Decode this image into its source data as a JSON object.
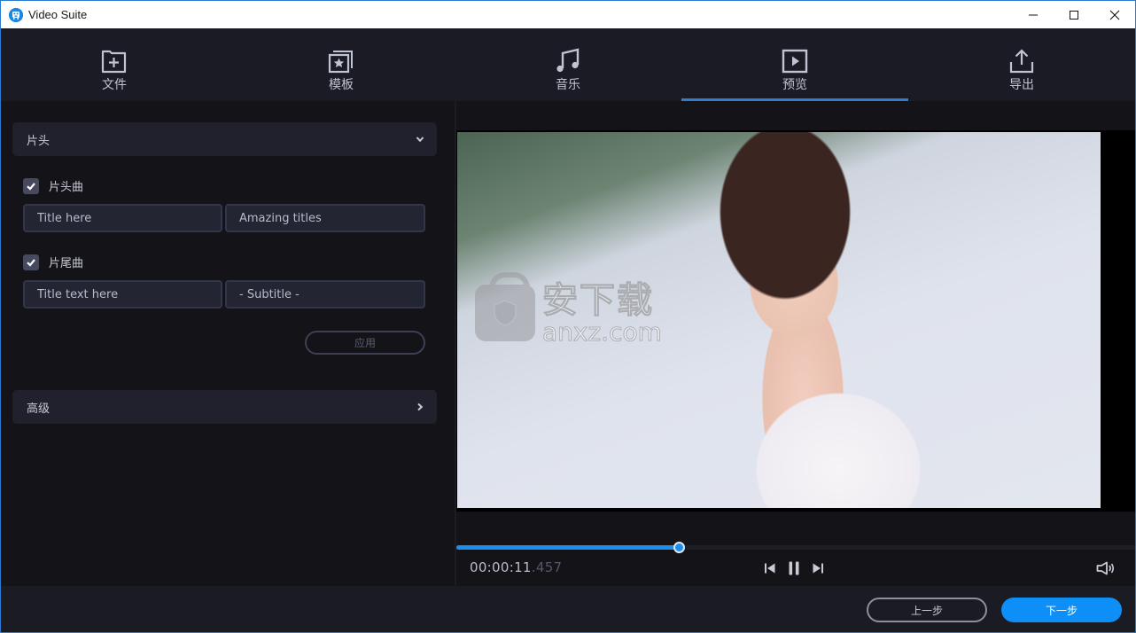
{
  "window": {
    "title": "Video Suite",
    "app_icon": "app-logo-icon",
    "controls": [
      "minimize-icon",
      "maximize-icon",
      "close-icon"
    ]
  },
  "nav": {
    "active_index": 3,
    "accent_color": "#2e7fd0",
    "items": [
      {
        "label": "文件",
        "icon": "folder-add-icon"
      },
      {
        "label": "模板",
        "icon": "template-star-icon"
      },
      {
        "label": "音乐",
        "icon": "music-note-icon"
      },
      {
        "label": "预览",
        "icon": "play-preview-icon"
      },
      {
        "label": "导出",
        "icon": "export-upload-icon"
      }
    ]
  },
  "left_panel": {
    "opening_section": {
      "label": "片头",
      "expanded": true,
      "icon": "chevron-down-icon"
    },
    "intro_music": {
      "label": "片头曲",
      "checked": true,
      "fields": [
        {
          "value": "Title here"
        },
        {
          "value": "Amazing titles"
        }
      ]
    },
    "outro_music": {
      "label": "片尾曲",
      "checked": true,
      "fields": [
        {
          "value": "Title text here"
        },
        {
          "value": "- Subtitle -"
        }
      ]
    },
    "apply_label": "应用",
    "advanced_section": {
      "label": "高级",
      "expanded": false,
      "icon": "chevron-right-icon"
    }
  },
  "preview": {
    "watermark": {
      "cn": "安下载",
      "en": "anxz.com"
    },
    "progress_fraction": 0.328,
    "timecode": {
      "main": "00:00:11",
      "ms": ".457"
    },
    "controls": [
      "previous-frame-icon",
      "pause-icon",
      "next-frame-icon"
    ],
    "volume_icon": "volume-icon",
    "accent_color": "#1b8ef0"
  },
  "footer": {
    "prev_label": "上一步",
    "next_label": "下一步",
    "next_color": "#0d8ff7"
  }
}
